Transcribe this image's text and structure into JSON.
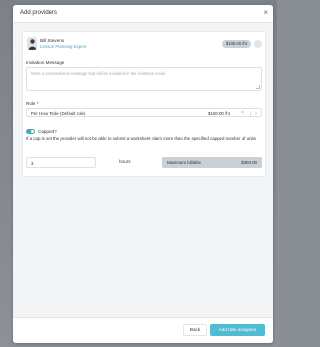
{
  "dialog": {
    "title": "Add providers",
    "close_icon": "close-icon"
  },
  "provider": {
    "name": "Bill Stevens",
    "role": "Lesson Planning Expert",
    "rate": "$100.00 /hr",
    "avatar_icon": "user-avatar"
  },
  "invitation": {
    "label": "Invitation Message",
    "placeholder": "Write a personalized message that will be included in the invitation email",
    "value": ""
  },
  "role_field": {
    "label": "Role *",
    "selected": "Per Hour Role (Default role)",
    "rate": "$100.00 /hr",
    "clear_icon": "×",
    "chevron_icon": "⌄"
  },
  "capped": {
    "label": "Capped?",
    "enabled": true,
    "help_text": "If a cap is set the provider will not be able to submit a worksheet claim more than the specified capped number of units"
  },
  "hours": {
    "value": "3",
    "unit": "hours"
  },
  "maximum": {
    "label": "Maximum billable",
    "value": "$300.00"
  },
  "footer": {
    "back_label": "Back",
    "add_label": "Add task assignee"
  },
  "colors": {
    "accent": "#3fa9c5",
    "primary_button": "#4fbcd3",
    "pill_background": "#c9d0d8"
  }
}
